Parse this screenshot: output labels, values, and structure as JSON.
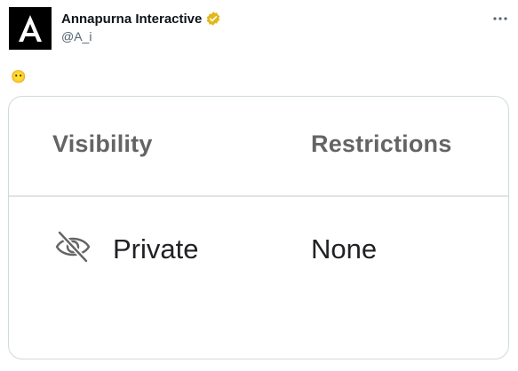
{
  "tweet": {
    "author_name": "Annapurna Interactive",
    "handle": "@A_i",
    "verified": true,
    "avatar_icon": "annapurna-logo-icon",
    "more_icon": "more-options-icon",
    "emoji": "😶"
  },
  "media": {
    "headers": {
      "visibility": "Visibility",
      "restrictions": "Restrictions"
    },
    "row": {
      "visibility_icon": "eye-off-icon",
      "visibility": "Private",
      "restrictions": "None"
    }
  },
  "colors": {
    "verified_badge": "#e2b719",
    "header_text": "#646464",
    "cell_text": "#202124",
    "card_border": "#cfd9de"
  }
}
